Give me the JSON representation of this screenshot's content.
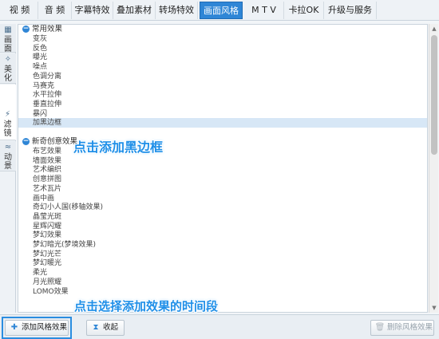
{
  "tabs": [
    {
      "label": "视  频",
      "active": false
    },
    {
      "label": "音  频",
      "active": false
    },
    {
      "label": "字幕特效",
      "active": false
    },
    {
      "label": "叠加素材",
      "active": false
    },
    {
      "label": "转场特效",
      "active": false
    },
    {
      "label": "画面风格",
      "active": true
    },
    {
      "label": "M T V",
      "active": false
    },
    {
      "label": "卡拉OK",
      "active": false
    },
    {
      "label": "升级与服务",
      "active": false
    }
  ],
  "side_tabs": [
    {
      "label": "画面",
      "icon": "grid-icon",
      "active": false
    },
    {
      "label": "美化",
      "icon": "magic-wand-icon",
      "active": false
    },
    {
      "label": "滤镜",
      "icon": "filter-wand-icon",
      "active": true
    },
    {
      "label": "动景",
      "icon": "wave-icon",
      "active": false
    }
  ],
  "groups": [
    {
      "title": "常用效果",
      "items": [
        "变灰",
        "反色",
        "曝光",
        "噪点",
        "色调分离",
        "马赛克",
        "水平拉伸",
        "垂直拉伸",
        "暴闪",
        "加黑边框"
      ]
    },
    {
      "title": "新奇创意效果",
      "items": [
        "布艺效果",
        "墙面效果",
        "艺术编织",
        "创意拼图",
        "艺术瓦片",
        "画中画",
        "奇幻小人国(移轴效果)",
        "晶莹光斑",
        "星辉闪耀",
        "梦幻效果",
        "梦幻暗光(梦境效果)",
        "梦幻光芒",
        "梦幻暖光",
        "柔光",
        "月光照耀",
        "LOMO效果"
      ]
    }
  ],
  "selected_item": "加黑边框",
  "hints": {
    "select_border": "点击添加黑边框",
    "select_time": "点击选择添加效果的时间段"
  },
  "buttons": {
    "add": "添加风格效果",
    "collapse": "收起",
    "remove": "删除风格效果"
  },
  "colors": {
    "accent": "#2f86d6",
    "selection": "#d7e7f6",
    "hint_text": "#1f8fe8"
  }
}
